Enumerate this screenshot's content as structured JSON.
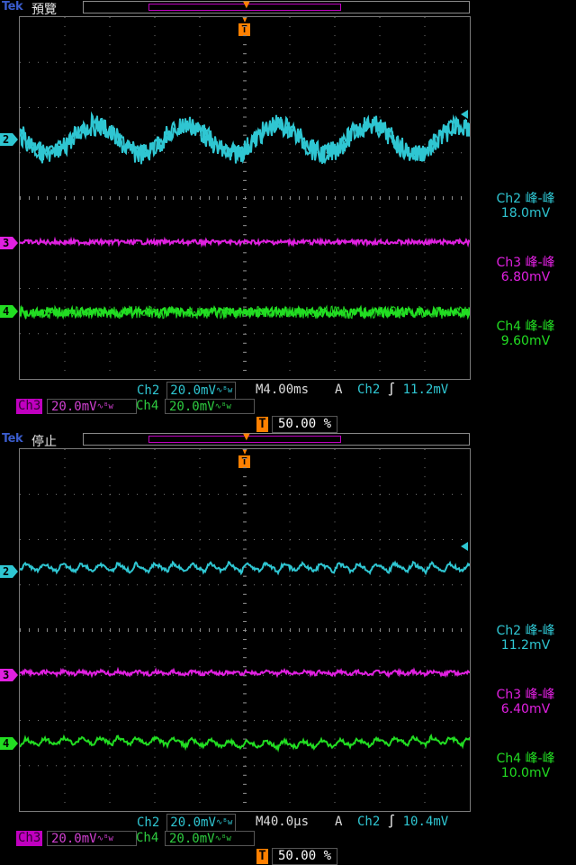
{
  "colors": {
    "ch2": "#2fc6d2",
    "ch3": "#e020e0",
    "ch4": "#22dd22",
    "trigger": "#ff8000",
    "grid": "#8a8a8a"
  },
  "scopes": [
    {
      "brand": "Tek",
      "status": "預覽",
      "markers": {
        "ch2": "2",
        "ch3": "3",
        "ch4": "4"
      },
      "measurements": [
        {
          "channel": "Ch2 峰-峰",
          "value": "18.0mV"
        },
        {
          "channel": "Ch3 峰-峰",
          "value": "6.80mV"
        },
        {
          "channel": "Ch4 峰-峰",
          "value": "9.60mV"
        }
      ],
      "ch2": {
        "label": "Ch2",
        "scale": "20.0mV"
      },
      "ch3": {
        "label": "Ch3",
        "scale": "20.0mV"
      },
      "ch4": {
        "label": "Ch4",
        "scale": "20.0mV"
      },
      "timebase": "M4.00ms",
      "trigger": {
        "mode": "A",
        "source": "Ch2",
        "level": "11.2mV"
      },
      "position": "50.00 %",
      "trigger_marker": "T"
    },
    {
      "brand": "Tek",
      "status": "停止",
      "markers": {
        "ch2": "2",
        "ch3": "3",
        "ch4": "4"
      },
      "measurements": [
        {
          "channel": "Ch2 峰-峰",
          "value": "11.2mV"
        },
        {
          "channel": "Ch3 峰-峰",
          "value": "6.40mV"
        },
        {
          "channel": "Ch4 峰-峰",
          "value": "10.0mV"
        }
      ],
      "ch2": {
        "label": "Ch2",
        "scale": "20.0mV"
      },
      "ch3": {
        "label": "Ch3",
        "scale": "20.0mV"
      },
      "ch4": {
        "label": "Ch4",
        "scale": "20.0mV"
      },
      "timebase": "M40.0µs",
      "trigger": {
        "mode": "A",
        "source": "Ch2",
        "level": "10.4mV"
      },
      "position": "50.00 %",
      "trigger_marker": "T"
    }
  ]
}
